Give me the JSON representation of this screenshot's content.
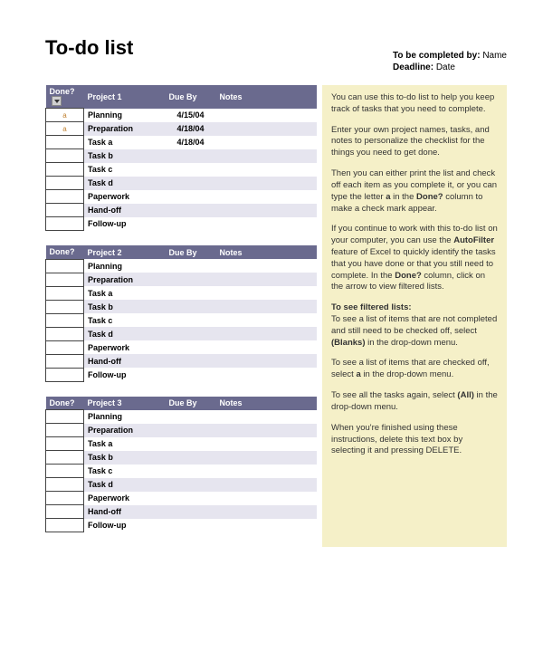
{
  "title": "To-do list",
  "meta": {
    "completed_by_label": "To be completed by: ",
    "completed_by_value": "Name",
    "deadline_label": "Deadline: ",
    "deadline_value": "Date"
  },
  "columns": {
    "done": "Done?",
    "due": "Due By",
    "notes": "Notes"
  },
  "projects": [
    {
      "name": "Project 1",
      "has_filter": true,
      "rows": [
        {
          "done": "a",
          "task": "Planning",
          "due": "4/15/04",
          "notes": ""
        },
        {
          "done": "a",
          "task": "Preparation",
          "due": "4/18/04",
          "notes": ""
        },
        {
          "done": "",
          "task": "Task a",
          "due": "4/18/04",
          "notes": ""
        },
        {
          "done": "",
          "task": "Task b",
          "due": "",
          "notes": ""
        },
        {
          "done": "",
          "task": "Task c",
          "due": "",
          "notes": ""
        },
        {
          "done": "",
          "task": "Task d",
          "due": "",
          "notes": ""
        },
        {
          "done": "",
          "task": "Paperwork",
          "due": "",
          "notes": ""
        },
        {
          "done": "",
          "task": "Hand-off",
          "due": "",
          "notes": ""
        },
        {
          "done": "",
          "task": "Follow-up",
          "due": "",
          "notes": ""
        }
      ]
    },
    {
      "name": "Project 2",
      "has_filter": false,
      "rows": [
        {
          "done": "",
          "task": "Planning",
          "due": "",
          "notes": ""
        },
        {
          "done": "",
          "task": "Preparation",
          "due": "",
          "notes": ""
        },
        {
          "done": "",
          "task": "Task a",
          "due": "",
          "notes": ""
        },
        {
          "done": "",
          "task": "Task b",
          "due": "",
          "notes": ""
        },
        {
          "done": "",
          "task": "Task c",
          "due": "",
          "notes": ""
        },
        {
          "done": "",
          "task": "Task d",
          "due": "",
          "notes": ""
        },
        {
          "done": "",
          "task": "Paperwork",
          "due": "",
          "notes": ""
        },
        {
          "done": "",
          "task": "Hand-off",
          "due": "",
          "notes": ""
        },
        {
          "done": "",
          "task": "Follow-up",
          "due": "",
          "notes": ""
        }
      ]
    },
    {
      "name": "Project 3",
      "has_filter": false,
      "rows": [
        {
          "done": "",
          "task": "Planning",
          "due": "",
          "notes": ""
        },
        {
          "done": "",
          "task": "Preparation",
          "due": "",
          "notes": ""
        },
        {
          "done": "",
          "task": "Task a",
          "due": "",
          "notes": ""
        },
        {
          "done": "",
          "task": "Task b",
          "due": "",
          "notes": ""
        },
        {
          "done": "",
          "task": "Task c",
          "due": "",
          "notes": ""
        },
        {
          "done": "",
          "task": "Task d",
          "due": "",
          "notes": ""
        },
        {
          "done": "",
          "task": "Paperwork",
          "due": "",
          "notes": ""
        },
        {
          "done": "",
          "task": "Hand-off",
          "due": "",
          "notes": ""
        },
        {
          "done": "",
          "task": "Follow-up",
          "due": "",
          "notes": ""
        }
      ]
    }
  ],
  "instructions": [
    {
      "text": "You can use this to-do list to help you keep track of tasks that you need to complete."
    },
    {
      "text": "Enter your own project names, tasks, and notes to personalize the checklist for the things you need to get done."
    },
    {
      "html": "Then you can either print the list and check off each item as you complete it, or you can type the letter <b>a</b> in the <b>Done?</b> column to make a check mark appear."
    },
    {
      "html": "If you continue to work with this to-do list on your computer, you can use the <b>AutoFilter</b> feature of Excel to quickly identify the tasks that you have done or that you still need to complete. In the <b>Done?</b> column, click on the arrow to view filtered lists."
    },
    {
      "html": "<b>To see filtered lists:</b><br>To see a list of items that are not completed and still need to be checked off, select <b>(Blanks)</b> in the drop-down menu."
    },
    {
      "html": "To see a list of items that are checked off, select <b>a</b> in the drop-down menu."
    },
    {
      "html": "To see all the tasks again, select <b>(All)</b> in the drop-down menu."
    },
    {
      "text": "When you're finished using these instructions, delete this text box by selecting it and pressing DELETE."
    }
  ]
}
